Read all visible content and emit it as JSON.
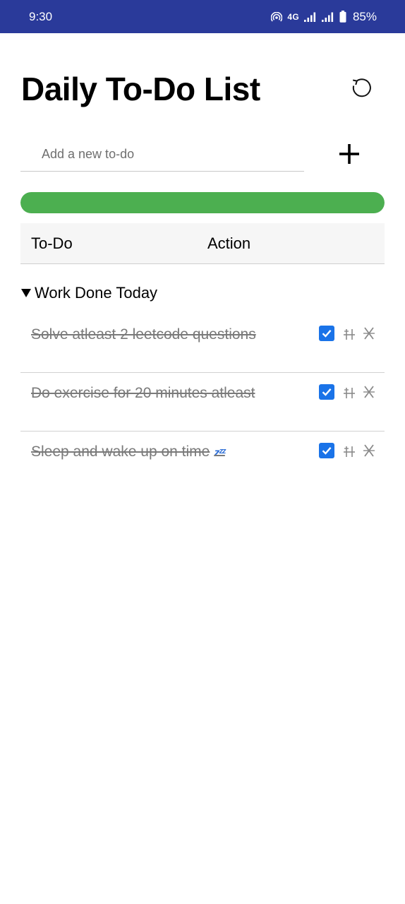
{
  "status_bar": {
    "time": "9:30",
    "network": "4G",
    "battery": "85%"
  },
  "header": {
    "title": "Daily To-Do List",
    "reset_icon": "refresh-icon"
  },
  "new_todo": {
    "placeholder": "Add a new to-do",
    "value": "",
    "add_icon": "plus-icon"
  },
  "progress": {
    "completed_fraction": 1.0,
    "color": "#4caf50"
  },
  "table": {
    "col_todo": "To-Do",
    "col_action": "Action"
  },
  "section": {
    "title": "Work Done Today",
    "expanded": true,
    "icon": "triangle-down-icon"
  },
  "todos": [
    {
      "text": "Solve atleast 2 leetcode questions",
      "emoji": "",
      "done": true
    },
    {
      "text": "Do exercise for 20 minutes atleast",
      "emoji": "",
      "done": true
    },
    {
      "text": "Sleep and wake up on time",
      "emoji": "zᶻᶻ",
      "done": true
    }
  ],
  "colors": {
    "status_bar": "#2a3a9a",
    "checkbox": "#1a73e8",
    "done_text": "#7a7a7a"
  }
}
